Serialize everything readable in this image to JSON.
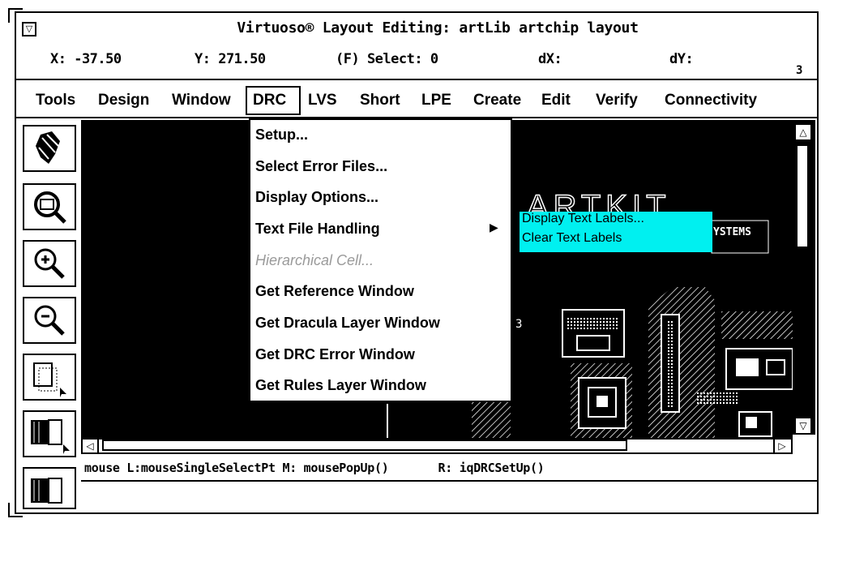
{
  "window": {
    "menu_button_glyph": "▽",
    "title": "Virtuoso® Layout Editing: artLib artchip layout"
  },
  "coords": {
    "x": "X: -37.50",
    "y": "Y: 271.50",
    "select": "(F) Select: 0",
    "dx": "dX:",
    "dy": "dY:",
    "cmd_count": "3"
  },
  "menubar": [
    "Tools",
    "Design",
    "Window",
    "DRC",
    "LVS",
    "Short",
    "LPE",
    "Create",
    "Edit",
    "Verify",
    "Connectivity"
  ],
  "drc_menu": {
    "items": [
      "Setup...",
      "Select Error Files...",
      "Display Options...",
      "Text File Handling",
      "Hierarchical Cell...",
      "Get Reference Window",
      "Get Dracula Layer Window",
      "Get DRC Error Window",
      "Get Rules Layer Window"
    ],
    "submenu_arrow": "▶"
  },
  "submenu": {
    "items": [
      "Display Text Labels...",
      "Clear Text Labels"
    ],
    "highlight_color": "#00f0f0"
  },
  "canvas": {
    "logo_text": "ARTKIT",
    "logo_subtext": "YSTEMS",
    "partial_text": "3"
  },
  "scrollbars": {
    "up": "△",
    "down": "▽",
    "left": "◁",
    "right": "▷"
  },
  "status": "mouse L:mouseSingleSelectPt M: mousePopUp()       R: iqDRCSetUp()",
  "icons": [
    "ruler-icon",
    "zoom-fit-icon",
    "zoom-in-icon",
    "zoom-out-icon",
    "select-area-icon",
    "select-layer-icon",
    "select-layer-icon-2"
  ]
}
